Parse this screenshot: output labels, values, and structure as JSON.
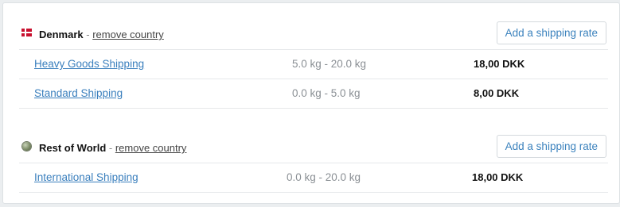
{
  "countries": [
    {
      "name": "Denmark",
      "separator": " - ",
      "remove_label": "remove country",
      "add_rate_label": "Add a shipping rate",
      "icon": "denmark-flag-icon",
      "rates": [
        {
          "name": "Heavy Goods Shipping",
          "weight": "5.0 kg - 20.0 kg",
          "price": "18,00 DKK"
        },
        {
          "name": "Standard Shipping",
          "weight": "0.0 kg - 5.0 kg",
          "price": "8,00 DKK"
        }
      ]
    },
    {
      "name": "Rest of World",
      "separator": " - ",
      "remove_label": "remove country",
      "add_rate_label": "Add a shipping rate",
      "icon": "globe-icon",
      "rates": [
        {
          "name": "International Shipping",
          "weight": "0.0 kg - 20.0 kg",
          "price": "18,00 DKK"
        }
      ]
    }
  ],
  "colors": {
    "link": "#3a7fbd",
    "flag_red": "#c8102e",
    "muted": "#8a8f94"
  }
}
